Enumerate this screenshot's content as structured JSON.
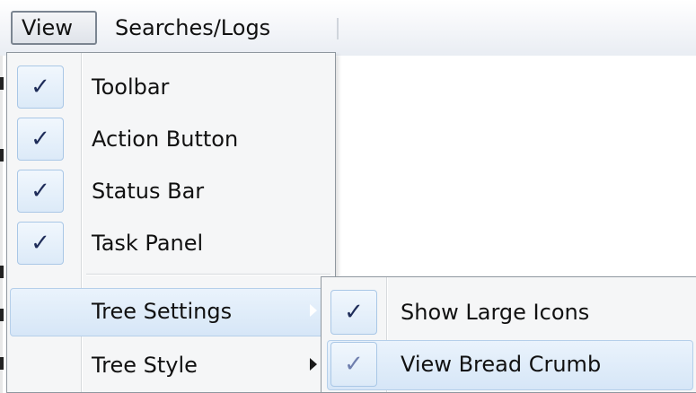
{
  "menubar": {
    "items": [
      {
        "label": "View"
      },
      {
        "label": "Searches/Logs"
      }
    ]
  },
  "view_menu": {
    "items": [
      {
        "label": "Toolbar",
        "checked": true,
        "check_glyph": "✓"
      },
      {
        "label": "Action Button",
        "checked": true,
        "check_glyph": "✓"
      },
      {
        "label": "Status Bar",
        "checked": true,
        "check_glyph": "✓"
      },
      {
        "label": "Task Panel",
        "checked": true,
        "check_glyph": "✓"
      },
      {
        "label": "Tree Settings",
        "submenu": true,
        "highlighted": true
      },
      {
        "label": "Tree Style",
        "submenu": true
      }
    ]
  },
  "tree_settings_submenu": {
    "items": [
      {
        "label": "Show Large Icons",
        "checked": true,
        "check_glyph": "✓"
      },
      {
        "label": "View Bread Crumb",
        "checked": true,
        "check_glyph": "✓",
        "highlighted": true
      }
    ]
  },
  "icons": {
    "check": "check-icon",
    "submenu_arrow": "chevron-right-icon"
  },
  "colors": {
    "menu_background": "#f5f6f7",
    "highlight": "#d6e6f7",
    "highlight_border": "#b5cfea",
    "checkmark": "#1f2d5a"
  }
}
